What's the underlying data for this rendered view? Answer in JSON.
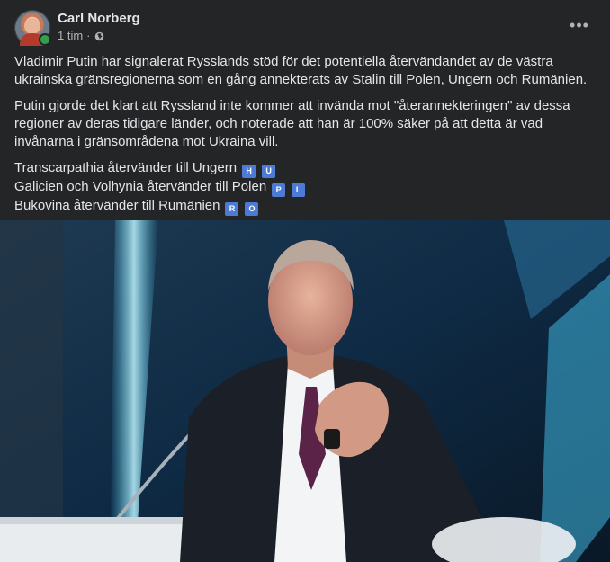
{
  "post": {
    "author": "Carl Norberg",
    "time": "1 tim",
    "privacy_icon": "globe-icon",
    "more_icon": "more-options-icon",
    "paragraphs": [
      "Vladimir Putin har signalerat Rysslands stöd för det potentiella återvändandet av de västra ukrainska gränsregionerna som en gång annekterats av Stalin till Polen, Ungern och Rumänien.",
      "Putin gjorde det klart att Ryssland inte kommer att invända mot \"återannekteringen\" av dessa regioner av deras tidigare länder, och noterade att han är 100% säker på att detta är vad invånarna i gränsområdena mot Ukraina vill."
    ],
    "flag_lines": [
      {
        "text": "Transcarpathia återvänder till Ungern",
        "badges": [
          "H",
          "U"
        ]
      },
      {
        "text": "Galicien och Volhynia återvänder till Polen",
        "badges": [
          "P",
          "L"
        ]
      },
      {
        "text": "Bukovina återvänder till Rumänien",
        "badges": [
          "R",
          "O"
        ]
      }
    ],
    "online_status_color": "#31a24c",
    "badge_color": "#4c7bd6"
  }
}
